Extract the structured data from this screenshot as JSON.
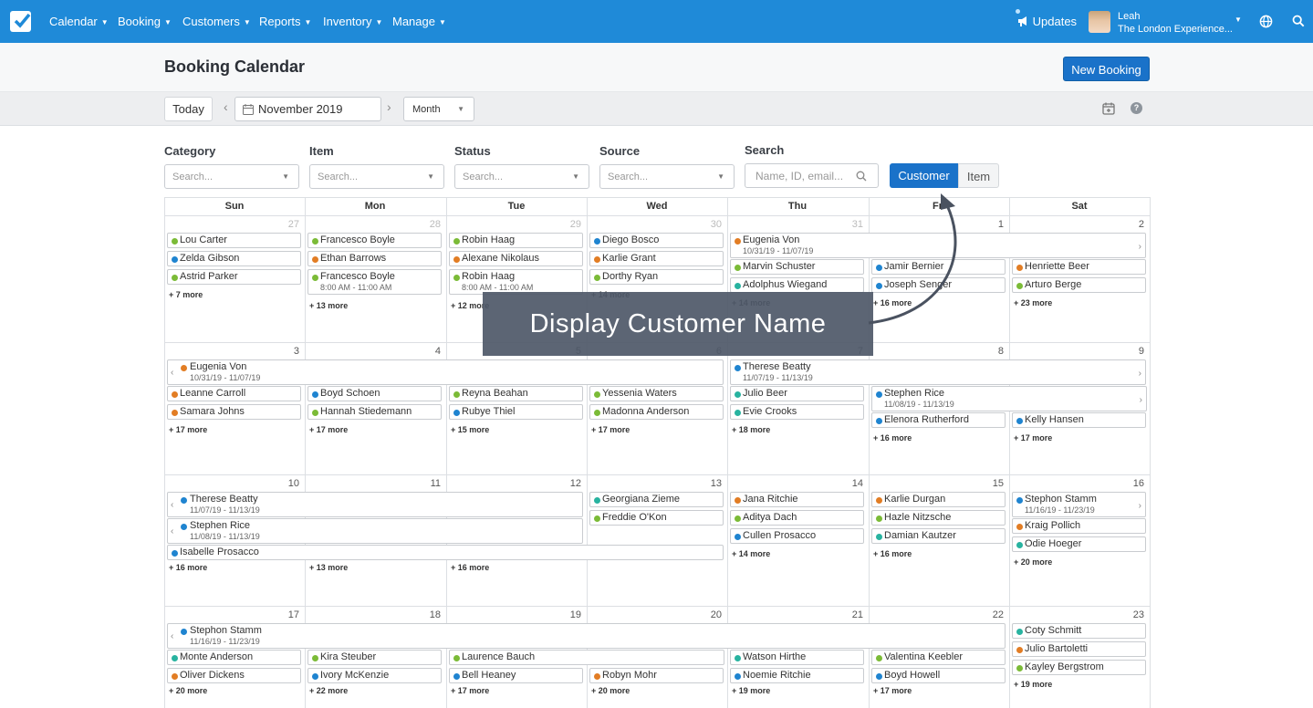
{
  "nav": {
    "menus": [
      "Calendar",
      "Booking",
      "Customers",
      "Reports",
      "Inventory",
      "Manage"
    ],
    "updates": "Updates",
    "user_name": "Leah",
    "user_org": "The London Experience..."
  },
  "page": {
    "title": "Booking Calendar",
    "new_booking": "New Booking"
  },
  "toolbar": {
    "today": "Today",
    "date": "November 2019",
    "view": "Month"
  },
  "filters": {
    "labels": [
      "Category",
      "Item",
      "Status",
      "Source",
      "Search"
    ],
    "placeholder": "Search...",
    "search_placeholder": "Name, ID, email...",
    "toggle_customer": "Customer",
    "toggle_item": "Item"
  },
  "weekdays": [
    "Sun",
    "Mon",
    "Tue",
    "Wed",
    "Thu",
    "Fri",
    "Sat"
  ],
  "colors": {
    "green": "#7bbb37",
    "blue": "#1f84d0",
    "orange": "#e27d24",
    "teal": "#28b3a0"
  },
  "overlay": "Display Customer Name",
  "weeks": [
    {
      "days": [
        "27",
        "28",
        "29",
        "30",
        "31",
        "1",
        "2"
      ],
      "muted": [
        true,
        true,
        true,
        true,
        true,
        false,
        false
      ],
      "spans": [
        {
          "col": 4,
          "len": 3,
          "row": 0,
          "name": "Eugenia Von",
          "dates": "10/31/19 - 11/07/19",
          "color": "orange",
          "left": false,
          "right": true
        }
      ],
      "events": [
        {
          "col": 0,
          "row": 0,
          "name": "Lou Carter",
          "color": "green"
        },
        {
          "col": 0,
          "row": 1,
          "name": "Zelda Gibson",
          "color": "blue"
        },
        {
          "col": 0,
          "row": 2,
          "name": "Astrid Parker",
          "color": "green"
        },
        {
          "col": 1,
          "row": 0,
          "name": "Francesco Boyle",
          "color": "green"
        },
        {
          "col": 1,
          "row": 1,
          "name": "Ethan Barrows",
          "color": "orange"
        },
        {
          "col": 1,
          "row": 2,
          "name": "Francesco Boyle",
          "color": "green",
          "time": "8:00 AM - 11:00 AM"
        },
        {
          "col": 2,
          "row": 0,
          "name": "Robin Haag",
          "color": "green"
        },
        {
          "col": 2,
          "row": 1,
          "name": "Alexane Nikolaus",
          "color": "orange"
        },
        {
          "col": 2,
          "row": 2,
          "name": "Robin Haag",
          "color": "green",
          "time": "8:00 AM - 11:00 AM"
        },
        {
          "col": 3,
          "row": 0,
          "name": "Diego Bosco",
          "color": "blue"
        },
        {
          "col": 3,
          "row": 1,
          "name": "Karlie Grant",
          "color": "orange"
        },
        {
          "col": 3,
          "row": 2,
          "name": "Dorthy Ryan",
          "color": "green"
        },
        {
          "col": 4,
          "row": 1.45,
          "name": "Marvin Schuster",
          "color": "green"
        },
        {
          "col": 4,
          "row": 2.45,
          "name": "Adolphus Wiegand",
          "color": "teal"
        },
        {
          "col": 5,
          "row": 1.45,
          "name": "Jamir Bernier",
          "color": "blue"
        },
        {
          "col": 5,
          "row": 2.45,
          "name": "Joseph Senger",
          "color": "blue"
        },
        {
          "col": 6,
          "row": 1.45,
          "name": "Henriette Beer",
          "color": "orange"
        },
        {
          "col": 6,
          "row": 2.45,
          "name": "Arturo Berge",
          "color": "green"
        }
      ],
      "more": [
        {
          "col": 0,
          "row": 3,
          "text": "+ 7 more"
        },
        {
          "col": 1,
          "row": 3.6,
          "text": "+ 13 more"
        },
        {
          "col": 2,
          "row": 3.6,
          "text": "+ 12 more"
        },
        {
          "col": 3,
          "row": 3,
          "text": "+ 14 more"
        },
        {
          "col": 4,
          "row": 3.45,
          "text": "+ 14 more"
        },
        {
          "col": 5,
          "row": 3.45,
          "text": "+ 16 more"
        },
        {
          "col": 6,
          "row": 3.45,
          "text": "+ 23 more"
        }
      ]
    },
    {
      "days": [
        "3",
        "4",
        "5",
        "6",
        "7",
        "8",
        "9"
      ],
      "muted": [
        false,
        false,
        false,
        false,
        false,
        false,
        false
      ],
      "spans": [
        {
          "col": 0,
          "len": 4,
          "row": 0,
          "name": "Eugenia Von",
          "dates": "10/31/19 - 11/07/19",
          "color": "orange",
          "left": true,
          "right": false
        },
        {
          "col": 4,
          "len": 3,
          "row": 0,
          "name": "Therese Beatty",
          "dates": "11/07/19 - 11/13/19",
          "color": "blue",
          "left": false,
          "right": true
        },
        {
          "col": 5,
          "len": 2,
          "row": 1.45,
          "name": "Stephen Rice",
          "dates": "11/08/19 - 11/13/19",
          "color": "blue",
          "left": false,
          "right": true
        }
      ],
      "events": [
        {
          "col": 0,
          "row": 1.45,
          "name": "Leanne Carroll",
          "color": "orange"
        },
        {
          "col": 0,
          "row": 2.45,
          "name": "Samara Johns",
          "color": "orange"
        },
        {
          "col": 1,
          "row": 1.45,
          "name": "Boyd Schoen",
          "color": "blue"
        },
        {
          "col": 1,
          "row": 2.45,
          "name": "Hannah Stiedemann",
          "color": "green"
        },
        {
          "col": 2,
          "row": 1.45,
          "name": "Reyna Beahan",
          "color": "green"
        },
        {
          "col": 2,
          "row": 2.45,
          "name": "Rubye Thiel",
          "color": "blue"
        },
        {
          "col": 3,
          "row": 1.45,
          "name": "Yessenia Waters",
          "color": "green"
        },
        {
          "col": 3,
          "row": 2.45,
          "name": "Madonna Anderson",
          "color": "green"
        },
        {
          "col": 4,
          "row": 1.45,
          "name": "Julio Beer",
          "color": "teal"
        },
        {
          "col": 4,
          "row": 2.45,
          "name": "Evie Crooks",
          "color": "teal"
        },
        {
          "col": 5,
          "row": 2.9,
          "name": "Elenora Rutherford",
          "color": "blue"
        },
        {
          "col": 6,
          "row": 2.9,
          "name": "Kelly Hansen",
          "color": "blue"
        }
      ],
      "more": [
        {
          "col": 0,
          "row": 3.45,
          "text": "+ 17 more"
        },
        {
          "col": 1,
          "row": 3.45,
          "text": "+ 17 more"
        },
        {
          "col": 2,
          "row": 3.45,
          "text": "+ 15 more"
        },
        {
          "col": 3,
          "row": 3.45,
          "text": "+ 17 more"
        },
        {
          "col": 4,
          "row": 3.45,
          "text": "+ 18 more"
        },
        {
          "col": 5,
          "row": 3.9,
          "text": "+ 16 more"
        },
        {
          "col": 6,
          "row": 3.9,
          "text": "+ 17 more"
        }
      ]
    },
    {
      "days": [
        "10",
        "11",
        "12",
        "13",
        "14",
        "15",
        "16"
      ],
      "muted": [
        false,
        false,
        false,
        false,
        false,
        false,
        false
      ],
      "spans": [
        {
          "col": 0,
          "len": 3,
          "row": 0,
          "name": "Therese Beatty",
          "dates": "11/07/19 - 11/13/19",
          "color": "blue",
          "left": true,
          "right": false
        },
        {
          "col": 0,
          "len": 3,
          "row": 1.45,
          "name": "Stephen Rice",
          "dates": "11/08/19 - 11/13/19",
          "color": "blue",
          "left": true,
          "right": false
        },
        {
          "col": 6,
          "len": 1,
          "row": 0,
          "name": "Stephon Stamm",
          "dates": "11/16/19 - 11/23/19",
          "color": "blue",
          "left": false,
          "right": true
        },
        {
          "col": 0,
          "len": 4,
          "row": 2.9,
          "name": "Isabelle Prosacco",
          "dates": "",
          "color": "blue",
          "left": false,
          "right": false
        }
      ],
      "events": [
        {
          "col": 3,
          "row": 0,
          "name": "Georgiana Zieme",
          "color": "teal"
        },
        {
          "col": 3,
          "row": 1,
          "name": "Freddie O'Kon",
          "color": "green"
        },
        {
          "col": 4,
          "row": 0,
          "name": "Jana Ritchie",
          "color": "orange"
        },
        {
          "col": 4,
          "row": 1,
          "name": "Aditya Dach",
          "color": "green"
        },
        {
          "col": 4,
          "row": 2,
          "name": "Cullen Prosacco",
          "color": "blue"
        },
        {
          "col": 5,
          "row": 0,
          "name": "Karlie Durgan",
          "color": "orange"
        },
        {
          "col": 5,
          "row": 1,
          "name": "Hazle Nitzsche",
          "color": "green"
        },
        {
          "col": 5,
          "row": 2,
          "name": "Damian Kautzer",
          "color": "teal"
        },
        {
          "col": 6,
          "row": 1.45,
          "name": "Kraig Pollich",
          "color": "orange"
        },
        {
          "col": 6,
          "row": 2.45,
          "name": "Odie Hoeger",
          "color": "teal"
        }
      ],
      "more": [
        {
          "col": 0,
          "row": 3.75,
          "text": "+ 16 more"
        },
        {
          "col": 1,
          "row": 3.75,
          "text": "+ 13 more"
        },
        {
          "col": 2,
          "row": 3.75,
          "text": "+ 16 more"
        },
        {
          "col": 4,
          "row": 3,
          "text": "+ 14 more"
        },
        {
          "col": 5,
          "row": 3,
          "text": "+ 16 more"
        },
        {
          "col": 6,
          "row": 3.45,
          "text": "+ 20 more"
        }
      ]
    },
    {
      "days": [
        "17",
        "18",
        "19",
        "20",
        "21",
        "22",
        "23"
      ],
      "muted": [
        false,
        false,
        false,
        false,
        false,
        false,
        false
      ],
      "spans": [
        {
          "col": 0,
          "len": 6,
          "row": 0,
          "name": "Stephon Stamm",
          "dates": "11/16/19 - 11/23/19",
          "color": "blue",
          "left": true,
          "right": false
        },
        {
          "col": 2,
          "len": 2,
          "row": 1.45,
          "name": "Laurence Bauch",
          "dates": "",
          "color": "green",
          "left": false,
          "right": false
        }
      ],
      "events": [
        {
          "col": 6,
          "row": 0,
          "name": "Coty Schmitt",
          "color": "teal"
        },
        {
          "col": 6,
          "row": 1,
          "name": "Julio Bartoletti",
          "color": "orange"
        },
        {
          "col": 6,
          "row": 2,
          "name": "Kayley Bergstrom",
          "color": "green"
        },
        {
          "col": 0,
          "row": 1.45,
          "name": "Monte Anderson",
          "color": "teal"
        },
        {
          "col": 0,
          "row": 2.45,
          "name": "Oliver Dickens",
          "color": "orange"
        },
        {
          "col": 1,
          "row": 1.45,
          "name": "Kira Steuber",
          "color": "green"
        },
        {
          "col": 1,
          "row": 2.45,
          "name": "Ivory McKenzie",
          "color": "blue"
        },
        {
          "col": 2,
          "row": 2.45,
          "name": "Bell Heaney",
          "color": "blue"
        },
        {
          "col": 3,
          "row": 2.45,
          "name": "Robyn Mohr",
          "color": "orange"
        },
        {
          "col": 4,
          "row": 1.45,
          "name": "Watson Hirthe",
          "color": "teal"
        },
        {
          "col": 4,
          "row": 2.45,
          "name": "Noemie Ritchie",
          "color": "blue"
        },
        {
          "col": 5,
          "row": 1.45,
          "name": "Valentina Keebler",
          "color": "green"
        },
        {
          "col": 5,
          "row": 2.45,
          "name": "Boyd Howell",
          "color": "blue"
        }
      ],
      "more": [
        {
          "col": 0,
          "row": 3.3,
          "text": "+ 20 more"
        },
        {
          "col": 1,
          "row": 3.3,
          "text": "+ 22 more"
        },
        {
          "col": 2,
          "row": 3.3,
          "text": "+ 17 more"
        },
        {
          "col": 3,
          "row": 3.3,
          "text": "+ 20 more"
        },
        {
          "col": 4,
          "row": 3.3,
          "text": "+ 19 more"
        },
        {
          "col": 5,
          "row": 3.3,
          "text": "+ 17 more"
        },
        {
          "col": 6,
          "row": 2.95,
          "text": "+ 19 more"
        }
      ]
    }
  ]
}
